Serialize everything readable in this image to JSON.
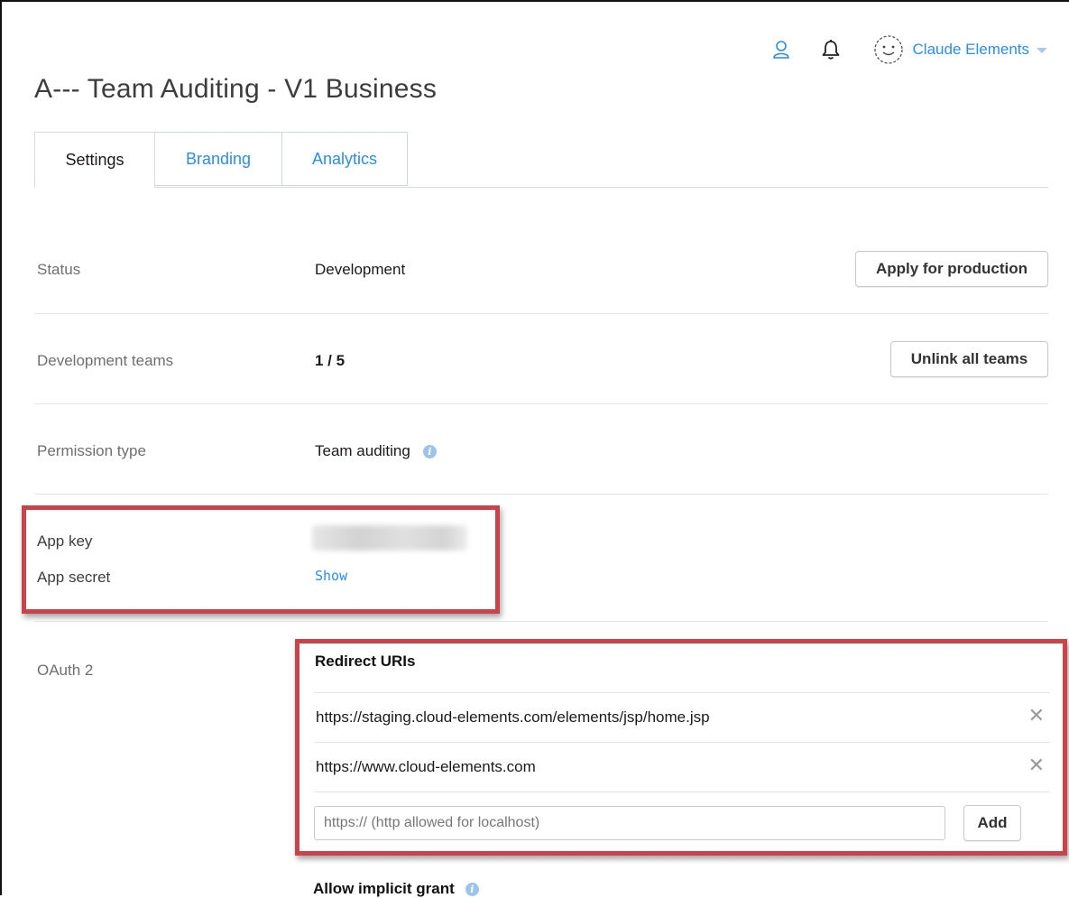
{
  "header": {
    "user_name": "Claude Elements",
    "icons": [
      "person-icon",
      "bell-icon",
      "avatar-smiley-icon",
      "caret-down-icon"
    ]
  },
  "page_title": "A--- Team Auditing - V1 Business",
  "tabs": [
    {
      "label": "Settings",
      "active": true
    },
    {
      "label": "Branding",
      "active": false
    },
    {
      "label": "Analytics",
      "active": false
    }
  ],
  "settings": {
    "status": {
      "label": "Status",
      "value": "Development",
      "button": "Apply for production"
    },
    "dev_teams": {
      "label": "Development teams",
      "value": "1 / 5",
      "button": "Unlink all teams"
    },
    "permission": {
      "label": "Permission type",
      "value": "Team auditing"
    },
    "app_key": {
      "label": "App key"
    },
    "app_secret": {
      "label": "App secret",
      "link": "Show"
    },
    "oauth": {
      "label": "OAuth 2",
      "redirect_title": "Redirect URIs",
      "redirect_uris": [
        "https://staging.cloud-elements.com/elements/jsp/home.jsp",
        "https://www.cloud-elements.com"
      ],
      "input_placeholder": "https:// (http allowed for localhost)",
      "add_label": "Add",
      "implicit_grant": "Allow implicit grant"
    }
  },
  "colors": {
    "accent": "#2b8ee6",
    "highlight": "#c9434a",
    "text": "#1e1919",
    "muted": "#6f6f6f"
  }
}
